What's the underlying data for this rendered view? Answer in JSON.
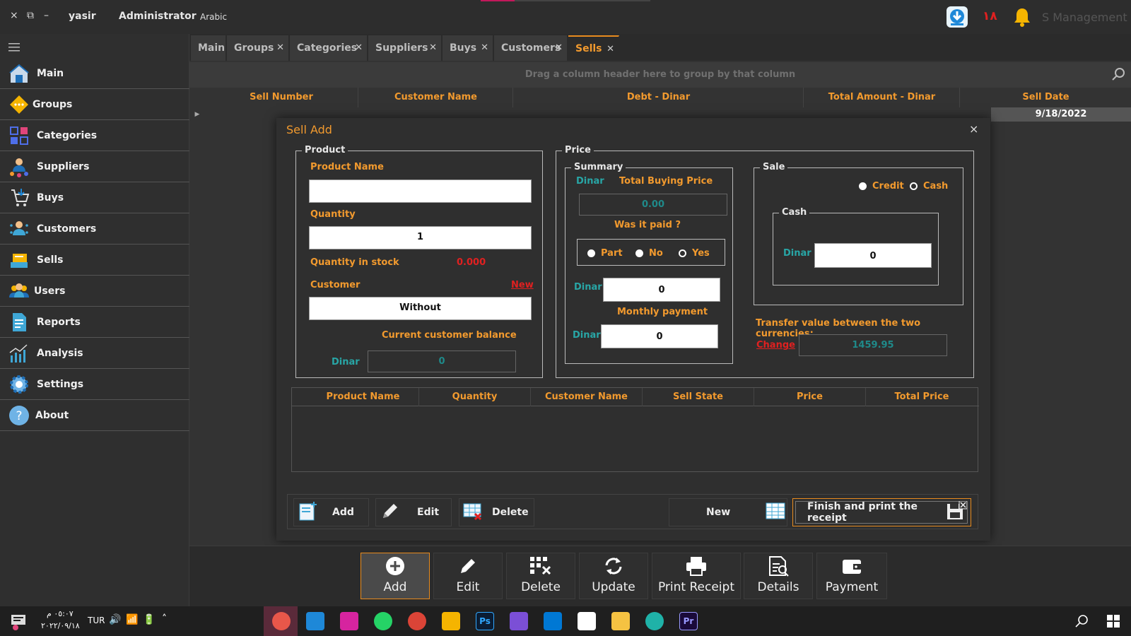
{
  "topbar": {
    "close": "×",
    "restore": "⧉",
    "minimize": "–",
    "username": "yasir",
    "role": "Administrator",
    "language": "Arabic",
    "day_badge": "١٨",
    "app_title": "S Management"
  },
  "sidebar": {
    "items": [
      {
        "label": "Main",
        "icon": "home-icon"
      },
      {
        "label": "Groups",
        "icon": "groups-icon"
      },
      {
        "label": "Categories",
        "icon": "categories-icon"
      },
      {
        "label": "Suppliers",
        "icon": "suppliers-icon"
      },
      {
        "label": "Buys",
        "icon": "buys-icon"
      },
      {
        "label": "Customers",
        "icon": "customers-icon"
      },
      {
        "label": "Sells",
        "icon": "sells-icon"
      },
      {
        "label": "Users",
        "icon": "users-icon"
      },
      {
        "label": "Reports",
        "icon": "reports-icon"
      },
      {
        "label": "Analysis",
        "icon": "analysis-icon"
      },
      {
        "label": "Settings",
        "icon": "settings-icon"
      },
      {
        "label": "About",
        "icon": "about-icon"
      }
    ]
  },
  "tabs": [
    {
      "label": "Main"
    },
    {
      "label": "Groups"
    },
    {
      "label": "Categories"
    },
    {
      "label": "Suppliers"
    },
    {
      "label": "Buys"
    },
    {
      "label": "Customers"
    },
    {
      "label": "Sells"
    }
  ],
  "grid": {
    "group_hint": "Drag a column header here to group by that column",
    "columns": [
      "Sell Number",
      "Customer Name",
      "Debt - Dinar",
      "Total Amount - Dinar",
      "Sell Date"
    ],
    "first_row_date": "9/18/2022"
  },
  "dialog": {
    "title": "Sell Add",
    "close": "×",
    "product": {
      "title": "Product",
      "product_name_label": "Product Name",
      "product_name_value": "",
      "quantity_label": "Quantity",
      "quantity_value": "1",
      "stock_label": "Quantity in stock",
      "stock_value": "0.000",
      "customer_label": "Customer",
      "new_link": "New",
      "customer_value": "Without",
      "balance_label": "Current customer balance",
      "balance_currency": "Dinar",
      "balance_value": "0"
    },
    "price": {
      "title": "Price",
      "summary": {
        "title": "Summary",
        "currency": "Dinar",
        "total_buying_label": "Total Buying Price",
        "total_buying_value": "0.00",
        "paid_label": "Was it paid ?",
        "options": [
          "Part",
          "No",
          "Yes"
        ],
        "paid_currency": "Dinar",
        "paid_value": "0",
        "monthly_label": "Monthly payment",
        "monthly_currency": "Dinar",
        "monthly_value": "0"
      },
      "sale": {
        "title": "Sale",
        "options": [
          "Credit",
          "Cash"
        ],
        "cash_title": "Cash",
        "cash_currency": "Dinar",
        "cash_value": "0"
      },
      "transfer_label": "Transfer value between the two currencies:",
      "change_link": "Change",
      "rate_value": "1459.95"
    },
    "table_columns": [
      "Product Name",
      "Quantity",
      "Customer Name",
      "Sell State",
      "Price",
      "Total Price"
    ],
    "buttons": {
      "add": "Add",
      "edit": "Edit",
      "delete": "Delete",
      "new": "New",
      "finish": "Finish and print the receipt"
    }
  },
  "toolbar": {
    "add": "Add",
    "edit": "Edit",
    "delete": "Delete",
    "update": "Update",
    "print": "Print Receipt",
    "details": "Details",
    "payment": "Payment"
  },
  "taskbar": {
    "time": "٠٥:٠٧ م",
    "date": "٢٠٢٢/٠٩/١٨",
    "lang": "TUR"
  },
  "colors": {
    "accent": "#f29a2e",
    "teal": "#28a6a6",
    "danger": "#e02020"
  }
}
